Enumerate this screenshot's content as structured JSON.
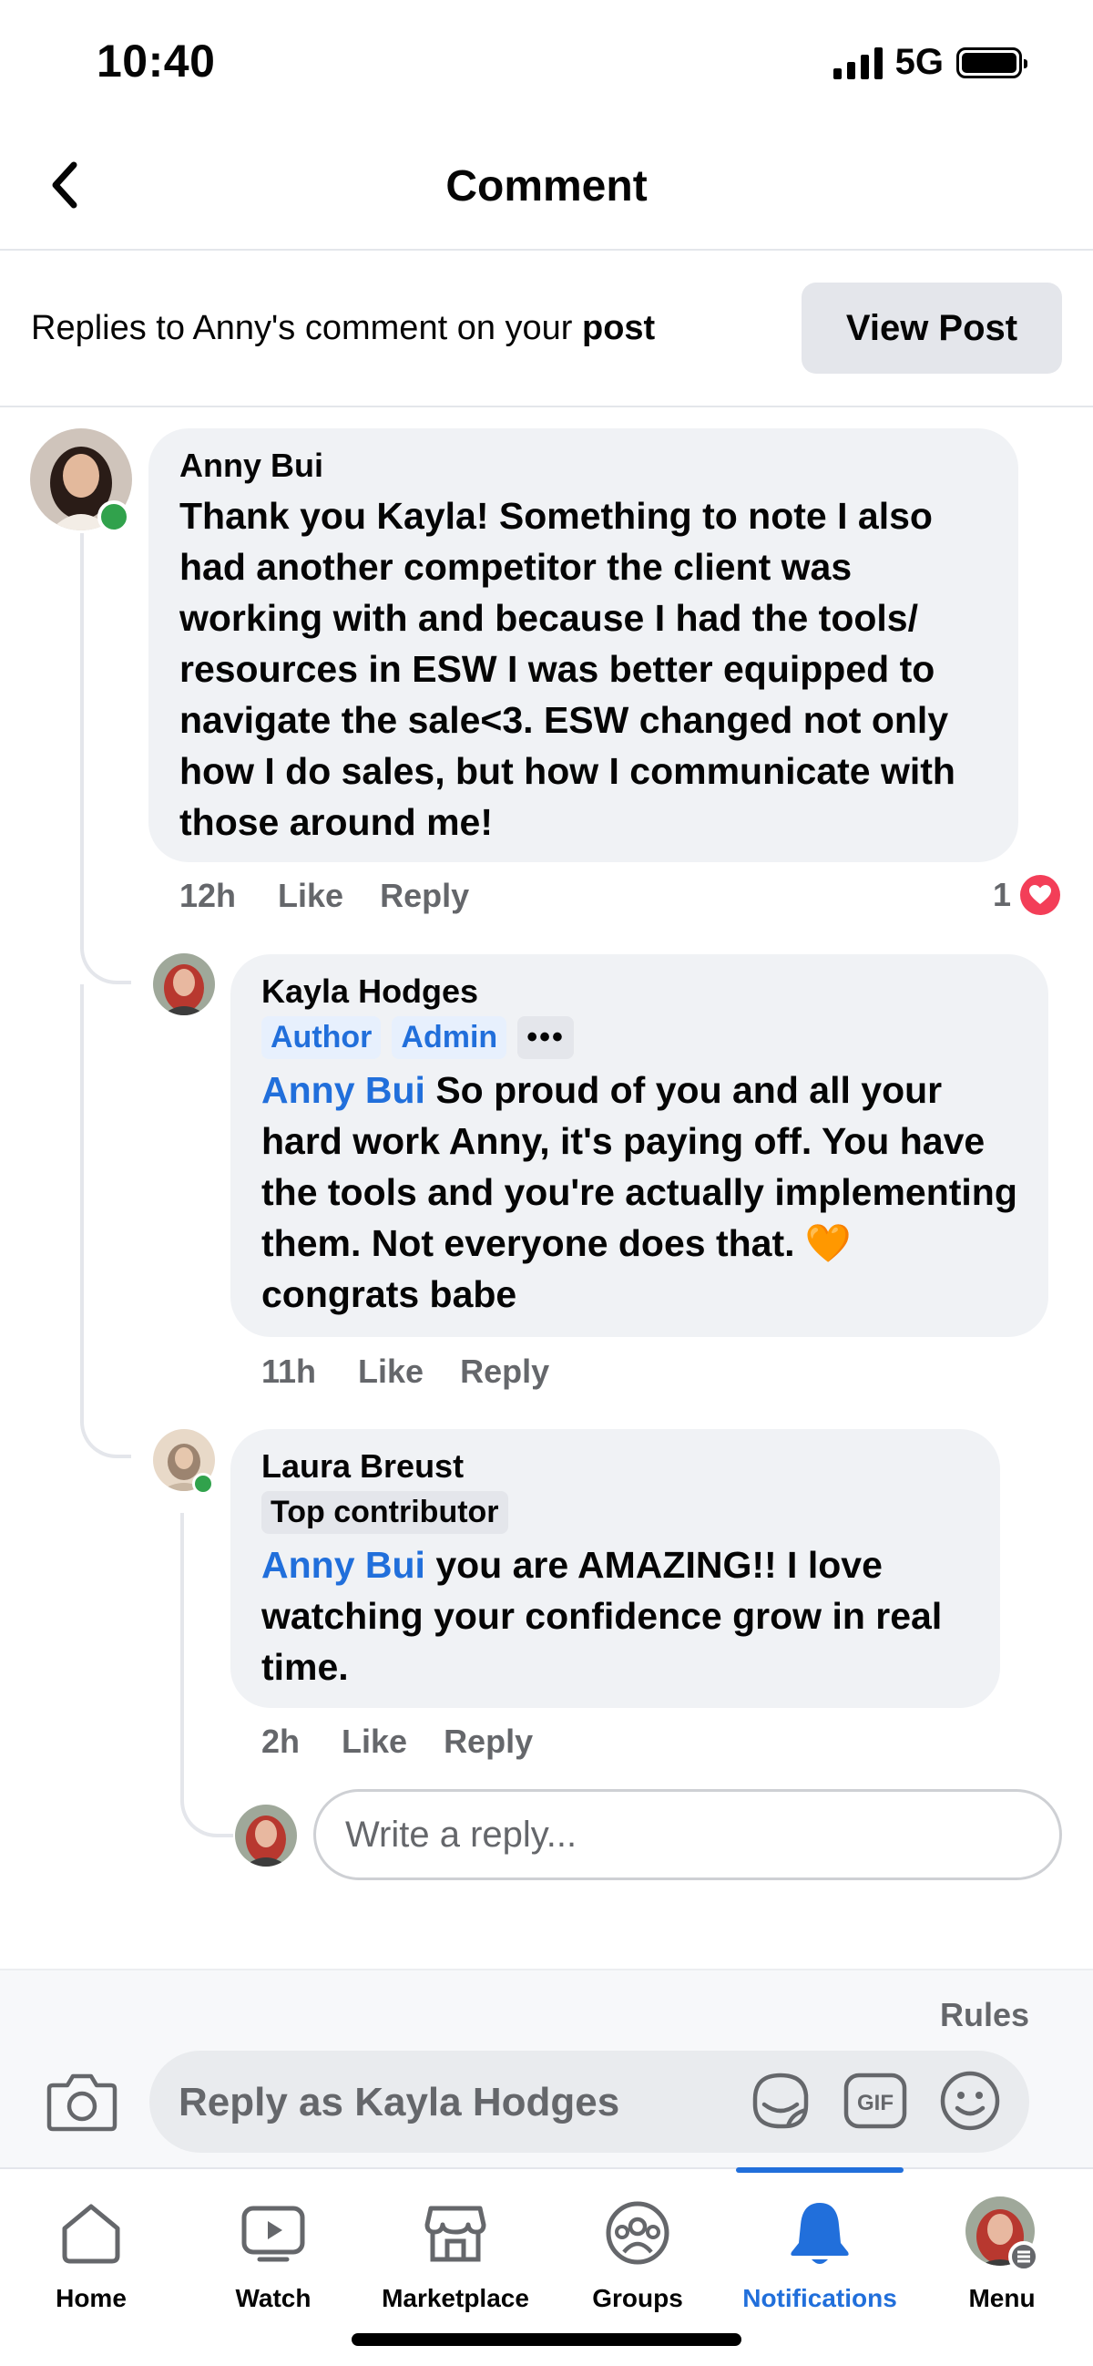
{
  "status_bar": {
    "time": "10:40",
    "network": "5G"
  },
  "header": {
    "title": "Comment"
  },
  "context": {
    "text_prefix": "Replies to Anny's comment on your ",
    "text_bold": "post",
    "view_post_label": "View Post"
  },
  "comments": [
    {
      "author": "Anny Bui",
      "text": "Thank you Kayla! Something to note I also had another competitor the client was working with and because I had the tools/ resources in ESW I was better equipped to navigate the sale<3. ESW changed not only how I do sales, but how I communicate with those around me!",
      "time": "12h",
      "like_label": "Like",
      "reply_label": "Reply",
      "reaction_count": "1"
    },
    {
      "author": "Kayla Hodges",
      "badges": [
        "Author",
        "Admin"
      ],
      "more_label": "•••",
      "mention": "Anny Bui",
      "text": " So proud of you and all your hard work Anny, it's paying off. You have the tools and you're actually implementing them. Not everyone does that. 🧡 congrats babe",
      "time": "11h",
      "like_label": "Like",
      "reply_label": "Reply"
    },
    {
      "author": "Laura Breust",
      "badges": [
        "Top contributor"
      ],
      "mention": "Anny Bui",
      "text": " you are AMAZING!! I love watching your confidence grow in real time.",
      "time": "2h",
      "like_label": "Like",
      "reply_label": "Reply"
    }
  ],
  "reply_box": {
    "placeholder": "Write a reply..."
  },
  "composer": {
    "rules_label": "Rules",
    "placeholder": "Reply as Kayla Hodges",
    "gif_label": "GIF"
  },
  "tabs": [
    {
      "label": "Home",
      "icon": "home-icon"
    },
    {
      "label": "Watch",
      "icon": "watch-icon"
    },
    {
      "label": "Marketplace",
      "icon": "marketplace-icon"
    },
    {
      "label": "Groups",
      "icon": "groups-icon"
    },
    {
      "label": "Notifications",
      "icon": "bell-icon",
      "active": true
    },
    {
      "label": "Menu",
      "icon": "menu-avatar"
    }
  ],
  "colors": {
    "accent": "#216fdb",
    "bubble": "#f0f2f5",
    "online": "#31a24c",
    "heart": "#f33e58"
  }
}
